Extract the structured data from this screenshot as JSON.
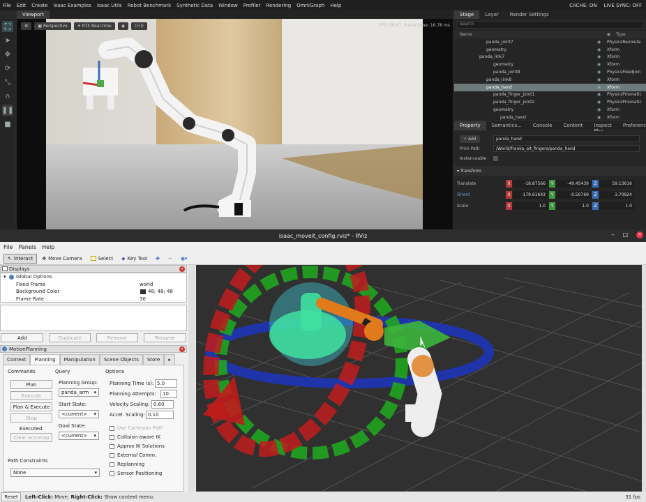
{
  "isaac": {
    "menu": [
      "File",
      "Edit",
      "Create",
      "Isaac Examples",
      "Isaac Utils",
      "Robot Benchmark",
      "Synthetic Data",
      "Window",
      "Profiler",
      "Rendering",
      "OmniGraph",
      "Help"
    ],
    "cache_label": "CACHE:",
    "cache_value": "ON",
    "livesync_label": "LIVE SYNC:",
    "livesync_value": "OFF",
    "viewport_tab": "Viewport",
    "viewport_chips": [
      "Perspective",
      "RTX Real-time"
    ],
    "fps_text": "FPS: 59.67, Frame time: 16.76 ms",
    "stage_tabs": [
      "Stage",
      "Layer",
      "Render Settings"
    ],
    "stage_search_placeholder": "Search",
    "stage_columns": {
      "name": "Name",
      "type": "Type"
    },
    "stage_rows": [
      {
        "name": "panda_joint7",
        "type": "PhysicsRevolute"
      },
      {
        "name": "geometry",
        "type": "Xform"
      },
      {
        "name": "panda_link7",
        "type": "Xform"
      },
      {
        "name": "geometry",
        "type": "Xform"
      },
      {
        "name": "panda_joint8",
        "type": "PhysicsFixedJoin"
      },
      {
        "name": "panda_link8",
        "type": "Xform"
      },
      {
        "name": "panda_hand",
        "type": "Xform"
      },
      {
        "name": "panda_finger_joint1",
        "type": "PhysicsPrismatic"
      },
      {
        "name": "panda_finger_joint2",
        "type": "PhysicsPrismatic"
      },
      {
        "name": "geometry",
        "type": "Xform"
      },
      {
        "name": "panda_hand",
        "type": "Xform"
      }
    ],
    "prop_tabs": [
      "Property",
      "Semantics...",
      "Console",
      "Content",
      "Inspect Phy...",
      "Preferences"
    ],
    "add_label": "Add",
    "prim_name": "panda_hand",
    "prim_path_label": "Prim Path",
    "prim_path": "/World/franka_alt_fingers/panda_hand",
    "instanceable_label": "Instanceable",
    "transform_label": "Transform",
    "translate_label": "Translate",
    "translate": [
      "-18.87566",
      "-49.45439",
      "59.13616"
    ],
    "orient_label": "Orient",
    "orient": [
      "-179.61643",
      "-0.50769",
      "3.70924"
    ],
    "scale_label": "Scale",
    "scale": [
      "1.0",
      "1.0",
      "1.0"
    ]
  },
  "rviz": {
    "title": "isaac_moveit_config.rviz* - RViz",
    "menu": [
      "File",
      "Panels",
      "Help"
    ],
    "tools": [
      "Interact",
      "Move Camera",
      "Select",
      "Key Tool"
    ],
    "displays_title": "Displays",
    "global_options": "Global Options",
    "display_rows": [
      {
        "k": "Fixed Frame",
        "v": "world"
      },
      {
        "k": "Background Color",
        "v": "48; 48; 48"
      },
      {
        "k": "Frame Rate",
        "v": "30"
      }
    ],
    "display_buttons": [
      "Add",
      "Duplicate",
      "Remove",
      "Rename"
    ],
    "mp_title": "MotionPlanning",
    "mp_tabs": [
      "Context",
      "Planning",
      "Manipulation",
      "Scene Objects",
      "Store"
    ],
    "commands_label": "Commands",
    "query_label": "Query",
    "options_label": "Options",
    "cmd_buttons": [
      "Plan",
      "Execute",
      "Plan & Execute",
      "Stop"
    ],
    "executed_label": "Executed",
    "clear_octomap": "Clear octomap",
    "planning_group_label": "Planning Group:",
    "planning_group": "panda_arm",
    "start_state_label": "Start State:",
    "start_state": "<current>",
    "goal_state_label": "Goal State:",
    "goal_state": "<current>",
    "options": [
      {
        "label": "Planning Time (s):",
        "value": "5.0"
      },
      {
        "label": "Planning Attempts:",
        "value": "10"
      },
      {
        "label": "Velocity Scaling:",
        "value": "0.60"
      },
      {
        "label": "Accel. Scaling:",
        "value": "0.10"
      }
    ],
    "checkboxes": [
      "Use Cartesian Path",
      "Collision-aware IK",
      "Approx IK Solutions",
      "External Comm.",
      "Replanning",
      "Sensor Positioning"
    ],
    "path_constraints_label": "Path Constraints",
    "path_constraints": "None",
    "reset_label": "Reset",
    "status_bold1": "Left-Click:",
    "status_text1": "Move.",
    "status_bold2": "Right-Click:",
    "status_text2": "Show context menu.",
    "fps": "31 fps"
  }
}
